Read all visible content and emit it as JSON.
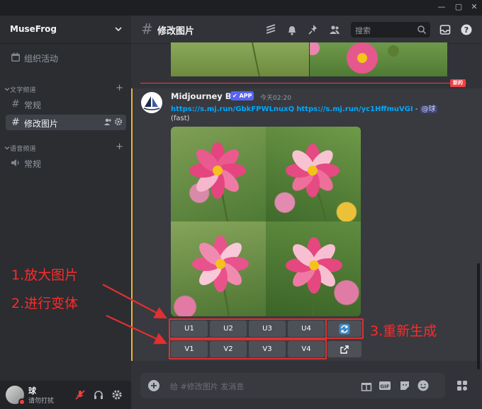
{
  "window": {
    "controls": [
      "—",
      "▢",
      "✕"
    ]
  },
  "sidebar": {
    "server_name": "MuseFrog",
    "top_item": {
      "label": "组织活动"
    },
    "categories": [
      {
        "label": "文字频道",
        "channels": [
          "常规",
          "修改图片"
        ]
      },
      {
        "label": "语音频道",
        "channels": [
          "常规"
        ]
      }
    ],
    "active_channel": "修改图片"
  },
  "user": {
    "name": "球",
    "status": "请勿打扰"
  },
  "header": {
    "channel": "修改图片",
    "search_placeholder": "搜索"
  },
  "new_badge": "新的",
  "message": {
    "author": "Midjourney Bot",
    "app_tag": "APP",
    "timestamp": "今天02:20",
    "link1": "https://s.mj.run/GbkFPWLnuxQ",
    "link2": "https://s.mj.run/yc1HffmuVGI",
    "separator": " - ",
    "mention": "@球",
    "mode": "(fast)"
  },
  "buttons": {
    "upscale": [
      "U1",
      "U2",
      "U3",
      "U4"
    ],
    "variation": [
      "V1",
      "V2",
      "V3",
      "V4"
    ]
  },
  "annotations": {
    "a1": "1.放大图片",
    "a2": "2.进行变体",
    "a3": "3.重新生成"
  },
  "composer": {
    "placeholder": "给 #修改图片 发消息"
  },
  "colors": {
    "accent": "#5865f2",
    "annotation": "#e03030",
    "link": "#00a8fc",
    "new": "#f23f43"
  }
}
